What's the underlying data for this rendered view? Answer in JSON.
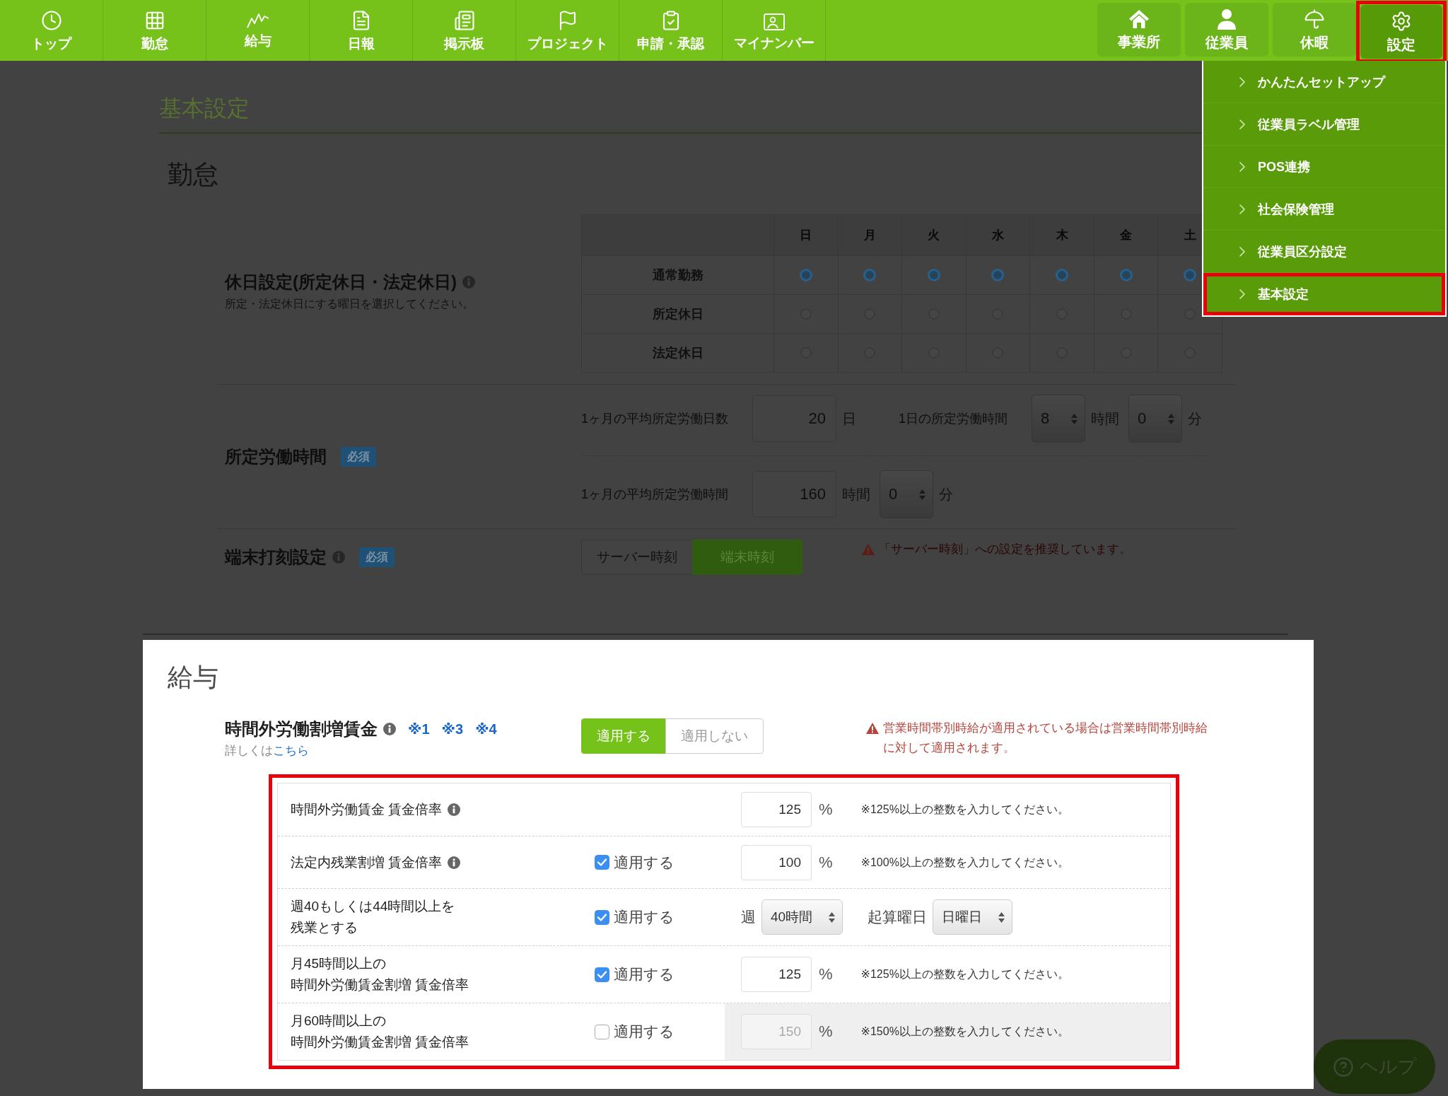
{
  "nav": {
    "main_items": [
      {
        "label": "トップ",
        "selected": false
      },
      {
        "label": "勤怠",
        "selected": false
      },
      {
        "label": "給与",
        "selected": false
      },
      {
        "label": "日報",
        "selected": false
      },
      {
        "label": "掲示板",
        "selected": false
      },
      {
        "label": "プロジェクト",
        "selected": false
      },
      {
        "label": "申請・承認",
        "selected": false
      },
      {
        "label": "マイナンバー",
        "selected": false
      }
    ],
    "admin_items": [
      {
        "label": "事業所",
        "selected": false,
        "highlighted": false
      },
      {
        "label": "従業員",
        "selected": false,
        "highlighted": false
      },
      {
        "label": "休暇",
        "selected": false,
        "highlighted": false
      },
      {
        "label": "設定",
        "selected": true,
        "highlighted": true
      }
    ]
  },
  "settings_menu": {
    "items": [
      {
        "label": "かんたんセットアップ",
        "highlighted": false
      },
      {
        "label": "従業員ラベル管理",
        "highlighted": false
      },
      {
        "label": "POS連携",
        "highlighted": false
      },
      {
        "label": "社会保険管理",
        "highlighted": false
      },
      {
        "label": "従業員区分設定",
        "highlighted": false
      },
      {
        "label": "基本設定",
        "highlighted": true
      }
    ]
  },
  "page": {
    "title": "基本設定",
    "dimmed": true
  },
  "sections": [
    {
      "kind": "attendance",
      "title": "勤怠",
      "dimmed": true,
      "holiday": {
        "label": "休日設定(所定休日・法定休日)",
        "has_info": true,
        "hint": "所定・法定休日にする曜日を選択してください。",
        "days": [
          "日",
          "月",
          "火",
          "水",
          "木",
          "金",
          "土"
        ],
        "rows": [
          {
            "label": "通常勤務",
            "cells": [
              {
                "selected": true
              },
              {
                "selected": true
              },
              {
                "selected": true
              },
              {
                "selected": true
              },
              {
                "selected": true
              },
              {
                "selected": true
              },
              {
                "selected": true
              }
            ]
          },
          {
            "label": "所定休日",
            "cells": [
              {
                "selected": false
              },
              {
                "selected": false
              },
              {
                "selected": false
              },
              {
                "selected": false
              },
              {
                "selected": false
              },
              {
                "selected": false
              },
              {
                "selected": false
              }
            ]
          },
          {
            "label": "法定休日",
            "cells": [
              {
                "selected": false
              },
              {
                "selected": false
              },
              {
                "selected": false
              },
              {
                "selected": false
              },
              {
                "selected": false
              },
              {
                "selected": false
              },
              {
                "selected": false
              }
            ]
          }
        ]
      },
      "work_hours": {
        "label": "所定労働時間",
        "badge": "必須",
        "lines": [
          {
            "items": [
              {
                "kind": "label",
                "text": "1ヶ月の平均所定労働日数"
              },
              {
                "kind": "input",
                "value": "20"
              },
              {
                "kind": "unit",
                "text": "日"
              },
              {
                "kind": "label",
                "text": "1日の所定労働時間"
              },
              {
                "kind": "select",
                "value": "8"
              },
              {
                "kind": "unit",
                "text": "時間"
              },
              {
                "kind": "select",
                "value": "0"
              },
              {
                "kind": "unit",
                "text": "分"
              }
            ]
          },
          {
            "items": [
              {
                "kind": "label",
                "text": "1ヶ月の平均所定労働時間"
              },
              {
                "kind": "input",
                "value": "160"
              },
              {
                "kind": "unit",
                "text": "時間"
              },
              {
                "kind": "select",
                "value": "0"
              },
              {
                "kind": "unit",
                "text": "分"
              }
            ]
          }
        ]
      },
      "terminal": {
        "label": "端末打刻設定",
        "has_info": true,
        "badge": "必須",
        "options": [
          {
            "label": "サーバー時刻",
            "selected": false
          },
          {
            "label": "端末時刻",
            "selected": true
          }
        ],
        "warning": "「サーバー時刻」への設定を推奨しています。"
      }
    },
    {
      "kind": "payroll",
      "title": "給与",
      "dimmed": false,
      "overtime": {
        "label": "時間外労働割増賃金",
        "has_info": true,
        "notes": [
          "※1",
          "※3",
          "※4"
        ],
        "hint": "詳しくは",
        "link": "こちら",
        "options": [
          {
            "label": "適用する",
            "selected": true
          },
          {
            "label": "適用しない",
            "selected": false
          }
        ],
        "warning": "営業時間帯別時給が適用されている場合は営業時間帯別時給に対して適用されます。"
      },
      "rates": {
        "highlighted": true,
        "rows": [
          {
            "kind": "rate",
            "label_lines": [
              "時間外労働賃金 賃金倍率"
            ],
            "has_info": true,
            "disabled": false,
            "value": "125",
            "unit": "%",
            "note": "※125%以上の整数を入力してください。"
          },
          {
            "kind": "rate",
            "label_lines": [
              "法定内残業割増 賃金倍率"
            ],
            "has_info": true,
            "checkbox": {
              "label": "適用する",
              "checked": true
            },
            "disabled": false,
            "value": "100",
            "unit": "%",
            "note": "※100%以上の整数を入力してください。"
          },
          {
            "kind": "weekly",
            "label_lines": [
              "週40もしくは44時間以上を",
              "残業とする"
            ],
            "has_info": false,
            "checkbox": {
              "label": "適用する",
              "checked": true
            },
            "disabled": false,
            "week_label": "週",
            "week_value": "40時間",
            "start_label": "起算曜日",
            "start_value": "日曜日"
          },
          {
            "kind": "rate",
            "label_lines": [
              "月45時間以上の",
              "時間外労働賃金割増 賃金倍率"
            ],
            "has_info": false,
            "checkbox": {
              "label": "適用する",
              "checked": true
            },
            "disabled": false,
            "value": "125",
            "unit": "%",
            "note": "※125%以上の整数を入力してください。"
          },
          {
            "kind": "rate",
            "label_lines": [
              "月60時間以上の",
              "時間外労働賃金割増 賃金倍率"
            ],
            "has_info": false,
            "checkbox": {
              "label": "適用する",
              "checked": false
            },
            "disabled": true,
            "value": "150",
            "unit": "%",
            "note": "※150%以上の整数を入力してください。"
          }
        ]
      }
    }
  ],
  "help_button": {
    "label": "ヘルプ",
    "dimmed": true
  }
}
